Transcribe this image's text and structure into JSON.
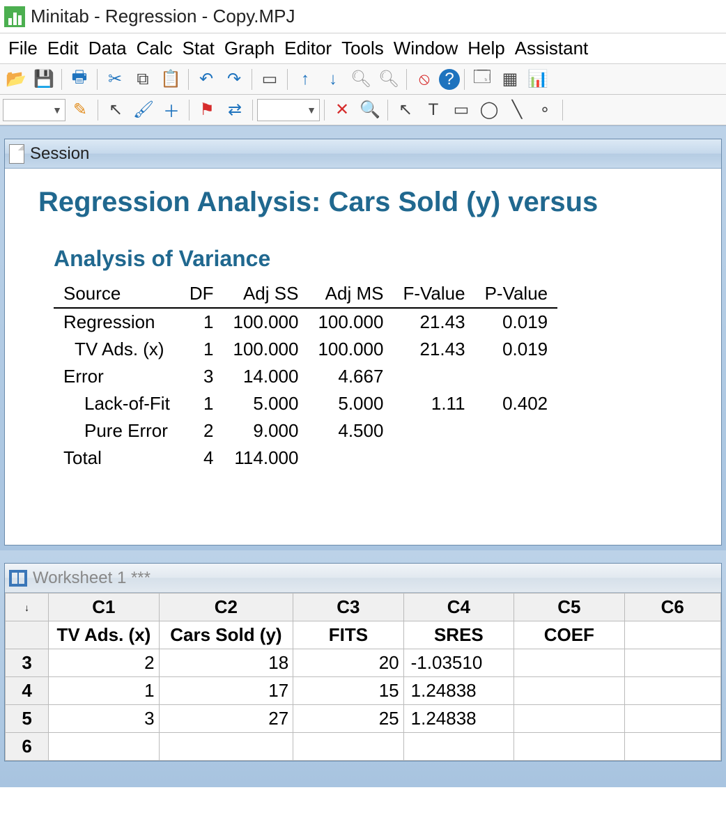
{
  "title": "Minitab - Regression - Copy.MPJ",
  "menu": [
    "File",
    "Edit",
    "Data",
    "Calc",
    "Stat",
    "Graph",
    "Editor",
    "Tools",
    "Window",
    "Help",
    "Assistant"
  ],
  "session": {
    "window_title": "Session",
    "report_title": "Regression Analysis: Cars Sold (y) versus ",
    "section": "Analysis of Variance",
    "anova_headers": [
      "Source",
      "DF",
      "Adj SS",
      "Adj MS",
      "F-Value",
      "P-Value"
    ],
    "anova_rows": [
      {
        "source": "Regression",
        "indent": 0,
        "df": "1",
        "adjss": "100.000",
        "adjms": "100.000",
        "f": "21.43",
        "p": "0.019"
      },
      {
        "source": "TV Ads. (x)",
        "indent": 1,
        "df": "1",
        "adjss": "100.000",
        "adjms": "100.000",
        "f": "21.43",
        "p": "0.019"
      },
      {
        "source": "Error",
        "indent": 0,
        "df": "3",
        "adjss": "14.000",
        "adjms": "4.667",
        "f": "",
        "p": ""
      },
      {
        "source": "Lack-of-Fit",
        "indent": 2,
        "df": "1",
        "adjss": "5.000",
        "adjms": "5.000",
        "f": "1.11",
        "p": "0.402"
      },
      {
        "source": "Pure Error",
        "indent": 2,
        "df": "2",
        "adjss": "9.000",
        "adjms": "4.500",
        "f": "",
        "p": ""
      },
      {
        "source": "Total",
        "indent": 0,
        "df": "4",
        "adjss": "114.000",
        "adjms": "",
        "f": "",
        "p": ""
      }
    ]
  },
  "worksheet": {
    "window_title": "Worksheet 1 ***",
    "corner": "↓",
    "col_ids": [
      "C1",
      "C2",
      "C3",
      "C4",
      "C5",
      "C6"
    ],
    "col_names": [
      "TV Ads. (x)",
      "Cars Sold (y)",
      "FITS",
      "SRES",
      "COEF",
      ""
    ],
    "rows": [
      {
        "id": "3",
        "cells": [
          "2",
          "18",
          "20",
          "-1.03510",
          "",
          ""
        ]
      },
      {
        "id": "4",
        "cells": [
          "1",
          "17",
          "15",
          "1.24838",
          "",
          ""
        ]
      },
      {
        "id": "5",
        "cells": [
          "3",
          "27",
          "25",
          "1.24838",
          "",
          ""
        ]
      },
      {
        "id": "6",
        "cells": [
          "",
          "",
          "",
          "",
          "",
          ""
        ]
      }
    ]
  },
  "chart_data": {
    "type": "table",
    "title": "Analysis of Variance",
    "columns": [
      "Source",
      "DF",
      "Adj SS",
      "Adj MS",
      "F-Value",
      "P-Value"
    ],
    "rows": [
      [
        "Regression",
        1,
        100.0,
        100.0,
        21.43,
        0.019
      ],
      [
        "TV Ads. (x)",
        1,
        100.0,
        100.0,
        21.43,
        0.019
      ],
      [
        "Error",
        3,
        14.0,
        4.667,
        null,
        null
      ],
      [
        "Lack-of-Fit",
        1,
        5.0,
        5.0,
        1.11,
        0.402
      ],
      [
        "Pure Error",
        2,
        9.0,
        4.5,
        null,
        null
      ],
      [
        "Total",
        4,
        114.0,
        null,
        null,
        null
      ]
    ]
  }
}
